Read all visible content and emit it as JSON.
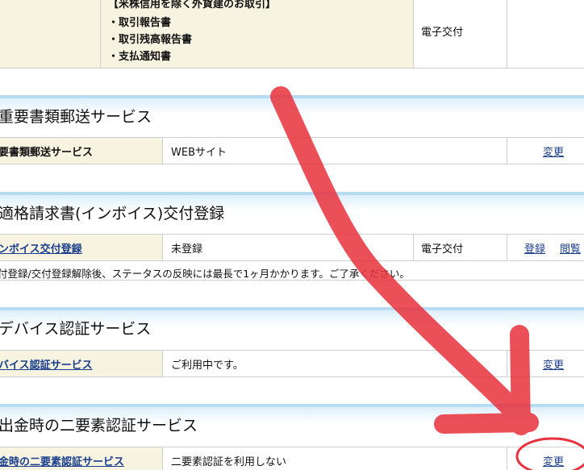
{
  "top_row": {
    "heading": "【米株信用を除く外貨建のお取引】",
    "items": [
      "・取引報告書",
      "・取引残高報告書",
      "・支払通知書"
    ],
    "delivery": "電子交付"
  },
  "sections": [
    {
      "title": "重要書類郵送サービス",
      "label": "要書類郵送サービス",
      "value": "WEBサイト",
      "actions": [
        "変更"
      ]
    },
    {
      "title": "適格請求書(インボイス)交付登録",
      "label": "ンボイス交付登録",
      "value": "未登録",
      "delivery": "電子交付",
      "actions": [
        "登録",
        "閲覧"
      ],
      "note": "付登録/交付登録解除後、ステータスの反映には最長で1ヶ月かかります。ご了承ください。"
    },
    {
      "title": "デバイス認証サービス",
      "label": "バイス認証サービス",
      "value": "ご利用中です。",
      "actions": [
        "変更"
      ]
    },
    {
      "title": "出金時の二要素認証サービス",
      "label": "金時の二要素認証サービス",
      "value": "二要素認証を利用しない",
      "actions": [
        "変更"
      ]
    }
  ],
  "annotation": {
    "color": "#e8313c"
  }
}
